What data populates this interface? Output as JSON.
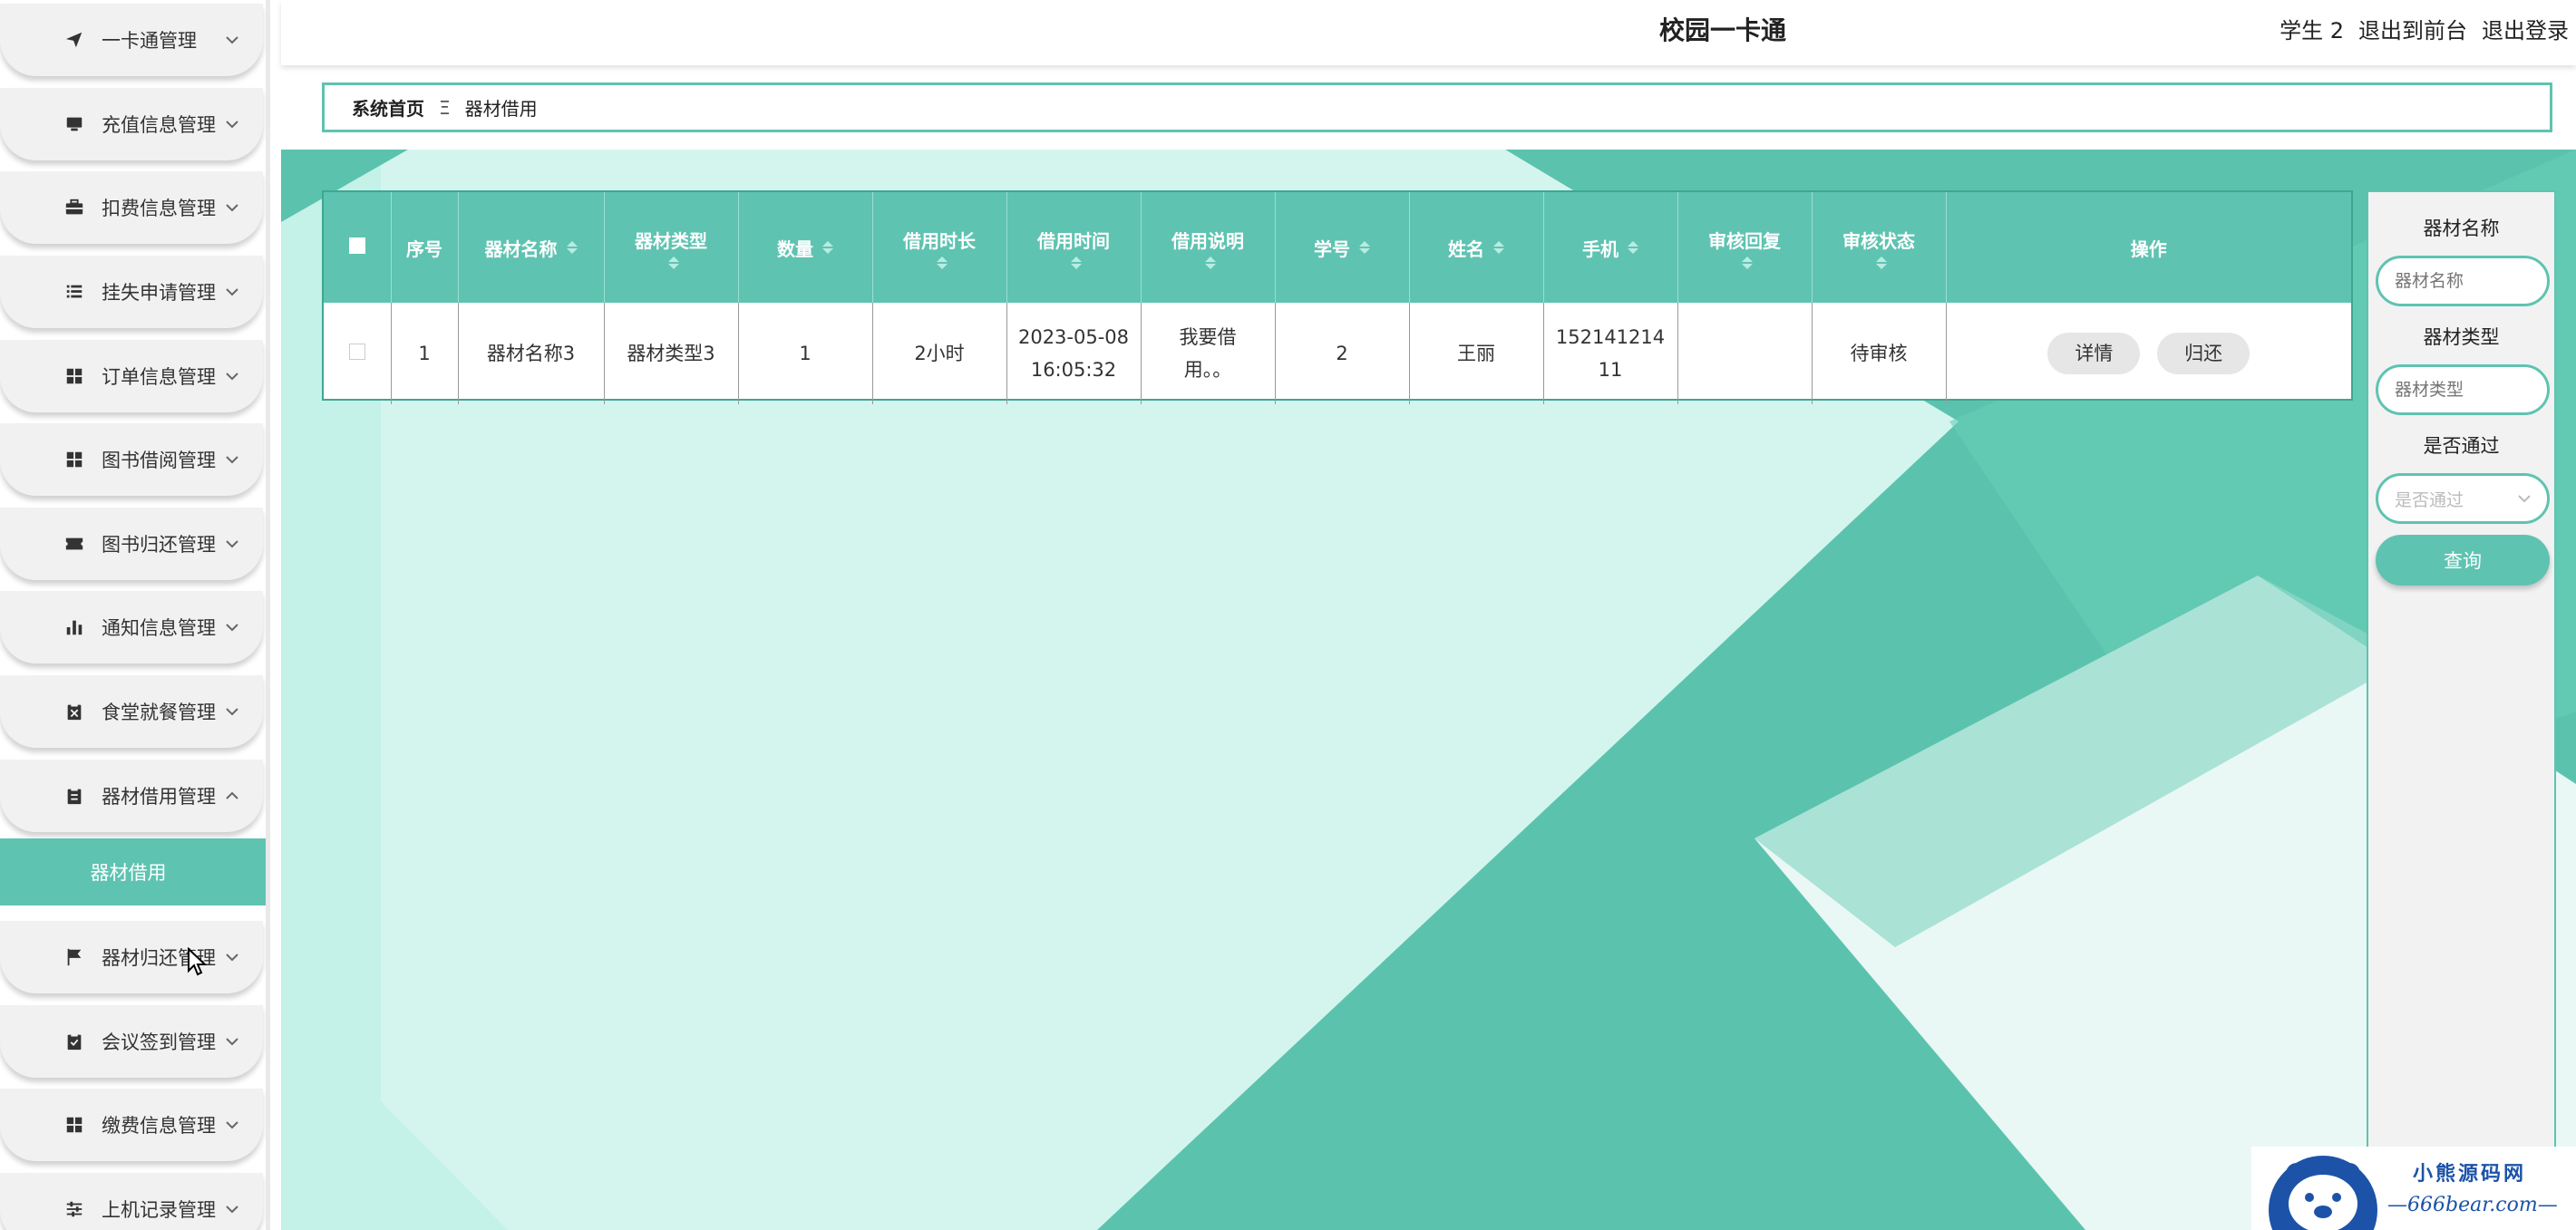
{
  "app_title": "校园一卡通",
  "user": {
    "name": "学生 2",
    "to_front": "退出到前台",
    "logout": "退出登录"
  },
  "breadcrumb": {
    "home": "系统首页",
    "separator": "Ξ",
    "current": "器材借用"
  },
  "sidebar": {
    "items": [
      {
        "label": "一卡通管理",
        "icon": "paper-plane-icon"
      },
      {
        "label": "充值信息管理",
        "icon": "monitor-icon"
      },
      {
        "label": "扣费信息管理",
        "icon": "briefcase-icon"
      },
      {
        "label": "挂失申请管理",
        "icon": "list-icon"
      },
      {
        "label": "订单信息管理",
        "icon": "grid-icon"
      },
      {
        "label": "图书借阅管理",
        "icon": "grid-icon"
      },
      {
        "label": "图书归还管理",
        "icon": "ticket-icon"
      },
      {
        "label": "通知信息管理",
        "icon": "bar-chart-icon"
      },
      {
        "label": "食堂就餐管理",
        "icon": "clipboard-x-icon"
      },
      {
        "label": "器材借用管理",
        "icon": "clipboard-icon",
        "expanded": true
      },
      {
        "label": "器材归还管理",
        "icon": "flag-icon"
      },
      {
        "label": "会议签到管理",
        "icon": "clipboard-check-icon"
      },
      {
        "label": "缴费信息管理",
        "icon": "grid-icon"
      },
      {
        "label": "上机记录管理",
        "icon": "sliders-icon"
      }
    ],
    "active_sub": "器材借用"
  },
  "table": {
    "headers": [
      "序号",
      "器材名称",
      "器材类型",
      "数量",
      "借用时长",
      "借用时间",
      "借用说明",
      "学号",
      "姓名",
      "手机",
      "审核回复",
      "审核状态",
      "操作"
    ],
    "rows": [
      {
        "index": "1",
        "name": "器材名称3",
        "type": "器材类型3",
        "qty": "1",
        "duration": "2小时",
        "time_1": "2023-05-08",
        "time_2": "16:05:32",
        "desc_1": "我要借",
        "desc_2": "用。。",
        "student_no": "2",
        "student_name": "王丽",
        "phone_1": "152141214",
        "phone_2": "11",
        "reply": "",
        "status": "待审核",
        "btn_detail": "详情",
        "btn_return": "归还"
      }
    ]
  },
  "search": {
    "name_label": "器材名称",
    "name_placeholder": "器材名称",
    "type_label": "器材类型",
    "type_placeholder": "器材类型",
    "pass_label": "是否通过",
    "pass_placeholder": "是否通过",
    "query_btn": "查询"
  },
  "watermark": {
    "line1": "小熊源码网",
    "line2": "—666bear.com—"
  },
  "colors": {
    "accent": "#5fc3b1",
    "bg_dark": "#5bc3ad",
    "bg_light": "#c6f2ea"
  }
}
